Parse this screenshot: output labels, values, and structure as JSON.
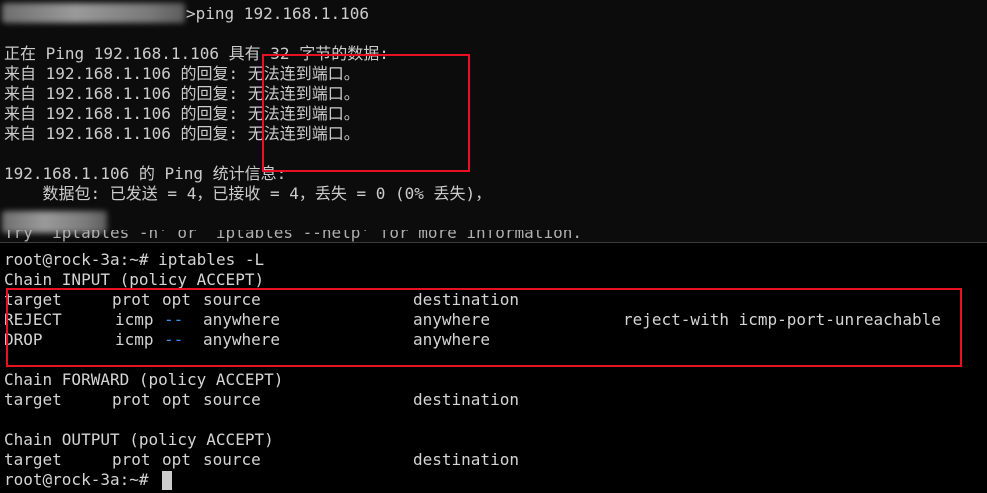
{
  "windows_cmd": {
    "prompt_suffix": ">",
    "ping_command": "ping 192.168.1.106",
    "header": "正在 Ping 192.168.1.106 具有 32 字节的数据:",
    "reply_prefix": "来自 192.168.1.106 的回复:",
    "reply_message": "无法连到端口。",
    "stats_title": "192.168.1.106 的 Ping 统计信息:",
    "stats_detail": "    数据包: 已发送 = 4，已接收 = 4，丢失 = 0 (0% 丢失)，"
  },
  "linux_terminal": {
    "cut_help_line": "Try `iptables -h' or `iptables --help' for more information.",
    "prompt": "root@rock-3a:~#",
    "command": "iptables -L",
    "chains": [
      {
        "header": "Chain INPUT (policy ACCEPT)",
        "columns": [
          "target",
          "prot",
          "opt",
          "source",
          "destination"
        ],
        "rules": [
          {
            "target": "REJECT",
            "prot": "icmp",
            "opt": "--",
            "source": "anywhere",
            "destination": "anywhere",
            "extra": "reject-with icmp-port-unreachable"
          },
          {
            "target": "DROP",
            "prot": "icmp",
            "opt": "--",
            "source": "anywhere",
            "destination": "anywhere",
            "extra": ""
          }
        ]
      },
      {
        "header": "Chain FORWARD (policy ACCEPT)",
        "columns": [
          "target",
          "prot",
          "opt",
          "source",
          "destination"
        ],
        "rules": []
      },
      {
        "header": "Chain OUTPUT (policy ACCEPT)",
        "columns": [
          "target",
          "prot",
          "opt",
          "source",
          "destination"
        ],
        "rules": []
      }
    ],
    "final_prompt": "root@rock-3a:~#"
  },
  "colors": {
    "highlight_box": "#e81123",
    "opt_dashes": "#3b8eea",
    "cursor": "#cccccc"
  }
}
